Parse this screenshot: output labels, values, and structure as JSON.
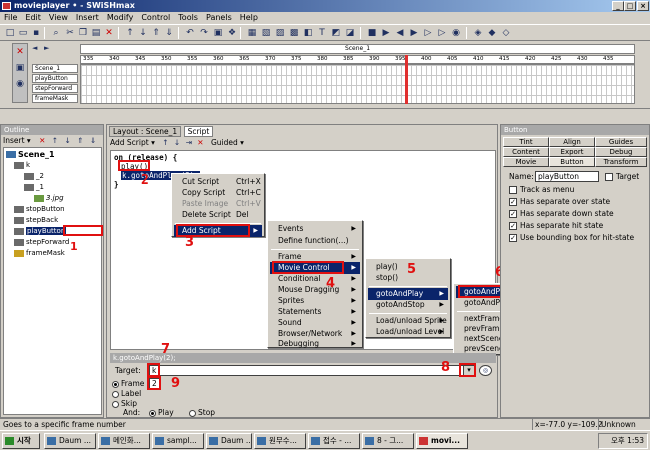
{
  "window": {
    "title": "movieplayer • - SWiSHmax"
  },
  "menubar": [
    "File",
    "Edit",
    "View",
    "Insert",
    "Modify",
    "Control",
    "Tools",
    "Panels",
    "Help"
  ],
  "timeline": {
    "scene_tab": "Scene_1",
    "ruler_ticks": [
      "335",
      "340",
      "345",
      "350",
      "355",
      "360",
      "365",
      "370",
      "375",
      "380",
      "385",
      "390",
      "395",
      "400",
      "405",
      "410",
      "415",
      "420",
      "425",
      "430",
      "435"
    ],
    "layers": [
      "Scene_1",
      "playButton",
      "stepForward",
      "frameMask"
    ]
  },
  "outline": {
    "title": "Outline",
    "insert_label": "Insert",
    "tree": [
      "Scene_1",
      "k",
      "_2",
      "_1",
      "3.jpg",
      "stopButton",
      "stepBack",
      "playButton",
      "stepForward",
      "frameMask"
    ]
  },
  "script": {
    "tabs": [
      "Layout : Scene_1",
      "Script"
    ],
    "add_script_label": "Add Script",
    "guided_label": "Guided",
    "code": {
      "line1": "on (release) {",
      "line2": "play()",
      "line3": "k.gotoAndPlay(2);",
      "line4": "}"
    },
    "context_menu": [
      {
        "label": "Cut Script",
        "shortcut": "Ctrl+X"
      },
      {
        "label": "Copy Script",
        "shortcut": "Ctrl+C"
      },
      {
        "label": "Paste Image",
        "shortcut": "Ctrl+V"
      },
      {
        "label": "Delete Script",
        "shortcut": "Del"
      },
      {
        "label": "Add Script",
        "shortcut": ""
      }
    ],
    "submenu_add": [
      "Events",
      "Define function(...)",
      "Frame",
      "Movie Control",
      "Conditional",
      "Mouse Dragging",
      "Sprites",
      "Statements",
      "Sound",
      "Browser/Network",
      "Debugging"
    ],
    "submenu_movie": [
      "play()",
      "stop()",
      "gotoAndPlay",
      "gotoAndStop",
      "Load/unload Sprite",
      "Load/unload Level"
    ],
    "submenu_goto": [
      "gotoAndPlay(FRAME)",
      "gotoAndPlay(LABEL)",
      "nextFrameAndPlay()",
      "prevFrameAndPlay()",
      "nextSceneAndPlay()",
      "prevSceneAndPlay()"
    ],
    "statement_bar": "k.gotoAndPlay(2);",
    "target_label": "Target:",
    "target_value": "k",
    "frame_label": "Frame",
    "frame_value": "2",
    "label_label": "Label",
    "skip_label": "Skip",
    "and_label": "And:",
    "play_label": "Play",
    "stop_label": "Stop"
  },
  "button_panel": {
    "title": "Button",
    "tabs_row1": [
      "Tint",
      "Align",
      "Guides"
    ],
    "tabs_row2": [
      "Content",
      "Export",
      "Debug"
    ],
    "tabs_row3": [
      "Movie",
      "Button",
      "Transform"
    ],
    "name_label": "Name:",
    "name_value": "playButton",
    "target_label": "Target",
    "checks": [
      {
        "label": "Track as menu",
        "checked": false
      },
      {
        "label": "Has separate over state",
        "checked": true
      },
      {
        "label": "Has separate down state",
        "checked": true
      },
      {
        "label": "Has separate hit state",
        "checked": true
      },
      {
        "label": "Use bounding box for hit-state",
        "checked": true
      }
    ]
  },
  "annotations": [
    "1",
    "2",
    "3",
    "4",
    "5",
    "6",
    "7",
    "8",
    "9"
  ],
  "status": {
    "left": "Goes to a specific frame number",
    "coords": "x=-77.0 y=-109.2",
    "state": "Unknown Size"
  },
  "taskbar": {
    "start": "시작",
    "tasks": [
      "Daum ...",
      "메인화...",
      "sampl...",
      "Daum ...",
      "원무수...",
      "접수 - ...",
      "8 - 그...",
      "movi..."
    ],
    "clock": "오후 1:53"
  },
  "colors": {
    "accent": "#0a246a",
    "annotation": "#e01010",
    "playhead": "#e03030"
  }
}
